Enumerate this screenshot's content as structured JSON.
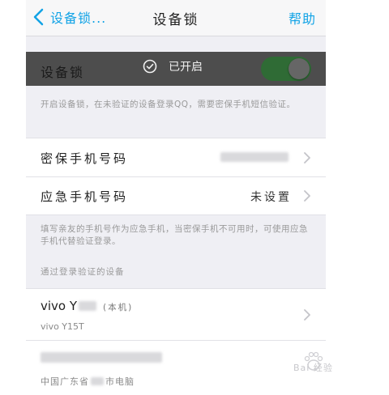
{
  "navbar": {
    "back_label": "设备锁...",
    "title": "设备锁",
    "help_label": "帮助"
  },
  "device_lock": {
    "label": "设备锁",
    "toast_text": "已开启",
    "enabled": true
  },
  "lock_desc": "开启设备锁，在未验证的设备登录QQ，需要密保手机短信验证。",
  "security_phone": {
    "label": "密保手机号码"
  },
  "emergency_phone": {
    "label": "应急手机号码",
    "value": "未设置"
  },
  "emergency_desc": "填写亲友的手机号作为应急手机，当密保手机不可用时，可使用应急手机代替验证登录。",
  "verified_section": {
    "label": "通过登录验证的设备"
  },
  "devices": [
    {
      "name": "vivo Y",
      "tag": "(本机)",
      "model": "vivo Y15T"
    },
    {
      "location": "中国广东省",
      "suffix": "市电脑"
    }
  ],
  "watermark": "Bai 经验",
  "colors": {
    "accent": "#12a3e6",
    "switch_on": "#2f6b35"
  }
}
